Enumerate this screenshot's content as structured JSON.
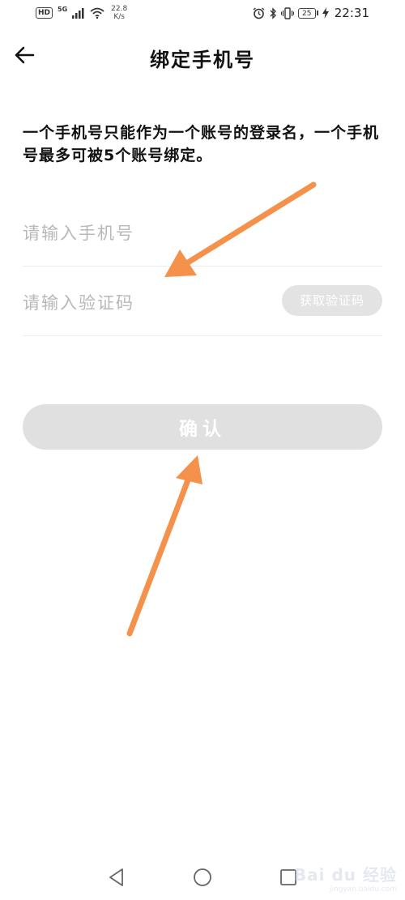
{
  "status_bar": {
    "hd": "HD",
    "network": "5G",
    "speed_value": "22.8",
    "speed_unit": "K/s",
    "battery": "25",
    "time": "22:31"
  },
  "header": {
    "title": "绑定手机号"
  },
  "description": "一个手机号只能作为一个账号的登录名，一个手机号最多可被5个账号绑定。",
  "form": {
    "phone_placeholder": "请输入手机号",
    "code_placeholder": "请输入验证码",
    "get_code_label": "获取验证码",
    "confirm_label": "确认"
  },
  "colors": {
    "annotation_arrow": "#f4914a",
    "disabled_button": "#e0e0e0",
    "placeholder": "#b8b8b8"
  },
  "icons": {
    "back": "arrow-left-icon",
    "nav_back": "triangle-back-icon",
    "nav_home": "circle-home-icon",
    "nav_recent": "square-recent-icon"
  },
  "watermark": {
    "logo": "Bai du 经验",
    "url": "jingyan.baidu.com"
  }
}
